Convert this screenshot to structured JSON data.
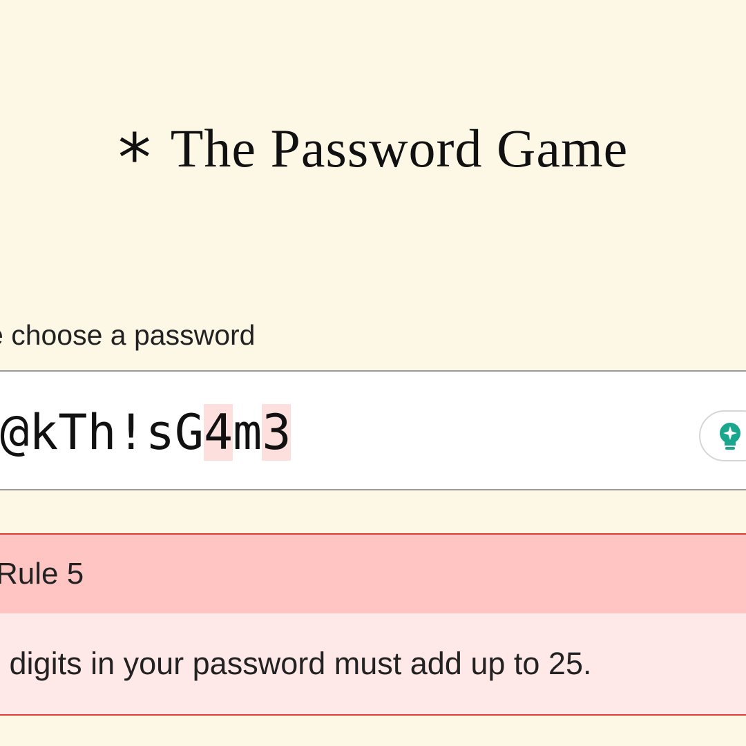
{
  "header": {
    "star_glyph": "*",
    "title": "The Password Game"
  },
  "prompt": {
    "label": "e choose a password"
  },
  "password": {
    "segments": [
      {
        "text": "@kTh!sG",
        "highlight": false
      },
      {
        "text": "4",
        "highlight": true
      },
      {
        "text": "m",
        "highlight": false
      },
      {
        "text": "3",
        "highlight": true
      }
    ],
    "highlight_color": "#fde0de"
  },
  "hint": {
    "icon": "lightbulb-icon",
    "color": "#1aa68c"
  },
  "rule": {
    "header": "Rule 5",
    "text": "e digits in your password must add up to 25.",
    "status": "failing",
    "header_bg": "#fec5c3",
    "body_bg": "#ffe9e8",
    "border": "#e23b3b"
  },
  "colors": {
    "background": "#fdf8e6"
  }
}
